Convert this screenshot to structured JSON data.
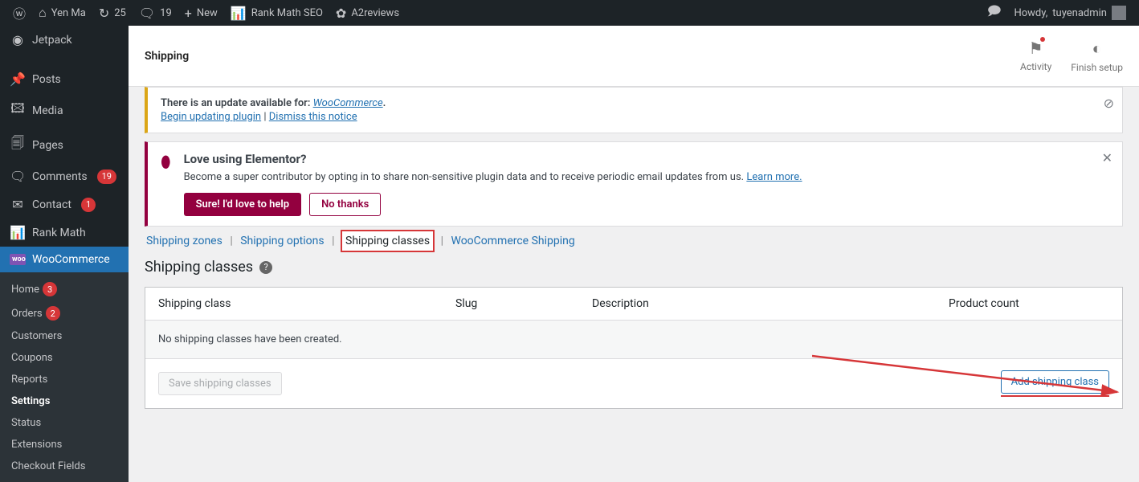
{
  "adminbar": {
    "site_name": "Yen Ma",
    "updates_count": "25",
    "comments_count": "19",
    "new_label": "New",
    "rank_math_label": "Rank Math SEO",
    "a2reviews_label": "A2reviews",
    "howdy_prefix": "Howdy,",
    "user_name": "tuyenadmin"
  },
  "sidebar": {
    "jetpack": "Jetpack",
    "posts": "Posts",
    "media": "Media",
    "pages": "Pages",
    "comments": "Comments",
    "comments_badge": "19",
    "contact": "Contact",
    "contact_badge": "1",
    "rank_math": "Rank Math",
    "woocommerce": "WooCommerce",
    "submenu": {
      "home": "Home",
      "home_badge": "3",
      "orders": "Orders",
      "orders_badge": "2",
      "customers": "Customers",
      "coupons": "Coupons",
      "reports": "Reports",
      "settings": "Settings",
      "status": "Status",
      "extensions": "Extensions",
      "checkout_fields": "Checkout Fields"
    }
  },
  "header": {
    "title": "Shipping",
    "activity": "Activity",
    "finish_setup": "Finish setup"
  },
  "notices": {
    "update_line": "There is an update available for:",
    "update_plugin": "WooCommerce",
    "begin_update": "Begin updating plugin",
    "dismiss": "Dismiss this notice",
    "elementor_title": "Love using Elementor?",
    "elementor_body": "Become a super contributor by opting in to share non-sensitive plugin data and to receive periodic email updates from us.",
    "learn_more": "Learn more.",
    "btn_yes": "Sure! I'd love to help",
    "btn_no": "No thanks"
  },
  "subtabs": {
    "zones": "Shipping zones",
    "options": "Shipping options",
    "classes": "Shipping classes",
    "wc_shipping": "WooCommerce Shipping"
  },
  "section": {
    "heading": "Shipping classes"
  },
  "table": {
    "col_class": "Shipping class",
    "col_slug": "Slug",
    "col_desc": "Description",
    "col_count": "Product count",
    "empty": "No shipping classes have been created.",
    "btn_save": "Save shipping classes",
    "btn_add": "Add shipping class"
  }
}
